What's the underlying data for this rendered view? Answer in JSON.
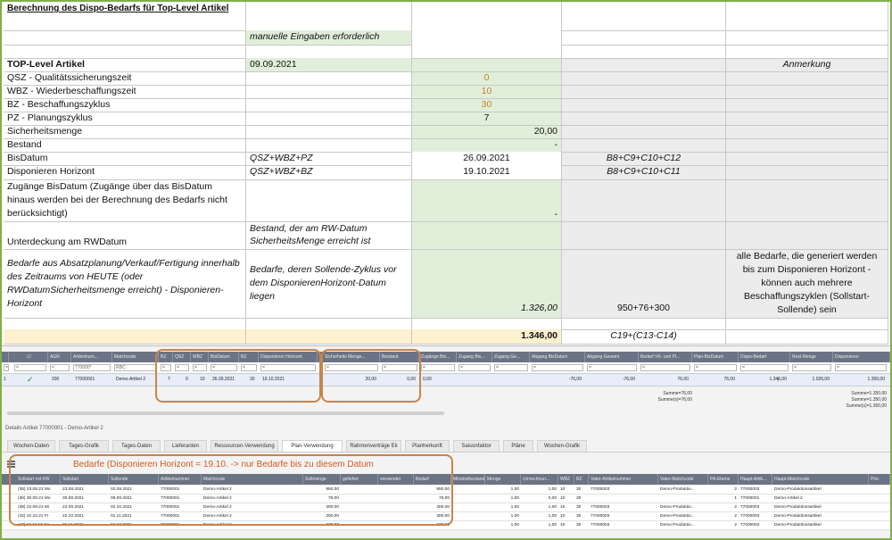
{
  "sheet": {
    "title": "Berechnung des Dispo-Bedarfs für Top-Level Artikel",
    "manual_note": "manuelle Eingaben erforderlich",
    "header_label": "TOP-Level Artikel",
    "header_date": "09.09.2021",
    "header_remark": "Anmerkung",
    "rows": [
      {
        "label": "QSZ - Qualitätssicherungszeit",
        "value": "0"
      },
      {
        "label": "WBZ - Wiederbeschaffungszeit",
        "value": "10"
      },
      {
        "label": "BZ - Beschaffungszyklus",
        "value": "30"
      },
      {
        "label": "PZ - Planungszyklus",
        "value": "7"
      },
      {
        "label": "Sicherheitsmenge",
        "value": "20,00"
      },
      {
        "label": "Bestand",
        "value": "-"
      }
    ],
    "bis_datum": {
      "label": "BisDatum",
      "formula": "QSZ+WBZ+PZ",
      "value": "26.09.2021",
      "excel": "B8+C9+C10+C12"
    },
    "horizont": {
      "label": "Disponieren Horizont",
      "formula": "QSZ+WBZ+BZ",
      "value": "19.10.2021",
      "excel": "B8+C9+C10+C11"
    },
    "zugaenge": {
      "label": "Zugänge BisDatum (Zugänge über das BisDatum hinaus werden bei der Berechnung des Bedarfs nicht berücksichtigt)",
      "value": "-"
    },
    "unterdeckung": {
      "label": "Unterdeckung am RWDatum",
      "desc": "Bestand, der am RW-Datum SicherheitsMenge erreicht ist"
    },
    "bedarfe": {
      "label": "Bedarfe aus Absatzplanung/Verkauf/Fertigung innerhalb des Zeitraums von HEUTE (oder RWDatumSicherheitsmenge erreicht) - Disponieren-Horizont",
      "desc": "Bedarfe, deren Sollende-Zyklus vor dem DisponierenHorizont-Datum liegen",
      "value": "1.326,00",
      "excel": "950+76+300",
      "remark": "alle Bedarfe, die generiert werden bis zum Disponieren Horizont - können auch mehrere Beschaffungszyklen (Sollstart-Sollende) sein"
    },
    "total": {
      "value": "1.346,00",
      "excel": "C19+(C13-C14)"
    }
  },
  "grid1": {
    "headers": [
      "",
      "AGR",
      "Artikelnum...",
      "Matchcode",
      "BZ",
      "QSZ",
      "WBZ",
      "BisDatum",
      "BZ",
      "Disponieren Horizont",
      "Sicherheits Menge...",
      "Bestand",
      "Zugänge Bis...",
      "Zugang Bis...",
      "Zugang Ge...",
      "Abgang BisDatum",
      "Abgang Gesamt",
      "Bedarf VK- und Pl...",
      "Plan-BisDatum",
      "Dispo-Bedarf",
      "Rest Menge",
      "Disponieren"
    ],
    "filter": [
      "=",
      "=",
      "770000*",
      "RBC",
      "=",
      "=",
      "=",
      "=",
      "=",
      "=",
      "=",
      "=",
      "=",
      "=",
      "=",
      "=",
      "=",
      "=",
      "=",
      "=",
      "=",
      "="
    ],
    "row": [
      "1",
      "200",
      "77000001",
      "Demo-Artikel 2",
      "7",
      "0",
      "10",
      "26.09.2021",
      "30",
      "19.10.2021",
      "20,00",
      "0,00",
      "0,00",
      "",
      "",
      "-76,00",
      "-76,00",
      "76,00",
      "76,00",
      "1.346,00",
      "1.026,00",
      "1.350,00"
    ],
    "sum1": "Summe=76,00\nSumme(s)=76,00",
    "sum2": "Summe=1.350,00\nSumme=1.350,00\nSumme(s)=1.350,00"
  },
  "details_title": "Details Artikel 77000001 - Demo-Artikel 2",
  "tabs": [
    "Wochen-Daten",
    "Tages-Grafik",
    "Tages-Daten",
    "Lieferanten",
    "Ressourcen-Verwendung",
    "Plan-Verwendung",
    "Rahmenverträge Ek",
    "Planherkunft",
    "Saisonfaktor",
    "Pläne",
    "Wochen-Grafik"
  ],
  "active_tab": "Plan-Verwendung",
  "note": "Bedarfe (Disponieren Horizont = 19.10. -> nur Bedarfe bis zu diesem Datum",
  "grid2": {
    "headers": [
      "Sollstart mit KW",
      "Sollstart",
      "Sollende",
      "Artikelnummer",
      "Matchcode",
      "Sollmenge",
      "geliefert",
      "verwendet",
      "Bedarf",
      "Mindestbestand",
      "Menge",
      "Umrechnun...",
      "WBZ",
      "BZ",
      "Vater-Artikelnummer",
      "Vater-Matchcode",
      "PA-Ebene",
      "Haupt-Artik...",
      "Haupt-Matchcode",
      "Prio"
    ],
    "rows": [
      [
        "(35) 23.08.21 Mo",
        "23.08.2021",
        "02.09.2021",
        "77000001",
        "Demo-Artikel 2",
        "950,00",
        "",
        "",
        "950,00",
        "",
        "1,00",
        "1,00",
        "10",
        "30",
        "77000003",
        "Demo-Produktio...",
        "2",
        "77000003",
        "Demo-Produktionsartikel",
        ""
      ],
      [
        "(36) 30.08.21 Mo",
        "30.08.2021",
        "09.09.2021",
        "77000001",
        "Demo-Artikel 2",
        "76,00",
        "",
        "",
        "76,00",
        "",
        "1,00",
        "0,00",
        "10",
        "30",
        "",
        "",
        "1",
        "77000001",
        "Demo-Artikel 2",
        ""
      ],
      [
        "(38) 22.09.21 Mi",
        "22.09.2021",
        "02.10.2021",
        "77000001",
        "Demo-Artikel 2",
        "300,00",
        "",
        "",
        "300,00",
        "",
        "1,00",
        "1,00",
        "10",
        "30",
        "77000003",
        "Demo-Produktio...",
        "2",
        "77000003",
        "Demo-Produktionsartikel",
        ""
      ],
      [
        "(42) 22.10.21 Fr",
        "22.10.2021",
        "01.11.2021",
        "77000001",
        "Demo-Artikel 2",
        "300,00",
        "",
        "",
        "300,00",
        "",
        "1,00",
        "1,00",
        "10",
        "30",
        "77000003",
        "Demo-Produktio...",
        "2",
        "77000003",
        "Demo-Produktionsartikel",
        ""
      ],
      [
        "(47) 21.11.21 So",
        "21.11.2021",
        "01.12.2021",
        "77000001",
        "Demo-Artikel 2",
        "230,00",
        "",
        "",
        "230,00",
        "",
        "1,00",
        "1,00",
        "10",
        "30",
        "77000003",
        "Demo-Produktio...",
        "2",
        "77000003",
        "Demo-Produktionsartikel",
        ""
      ]
    ]
  },
  "colors": {
    "accent_orange": "#c8844a",
    "note_red": "#d45a1e",
    "green_cell": "#e1efda",
    "header_grey": "#6b7484"
  }
}
